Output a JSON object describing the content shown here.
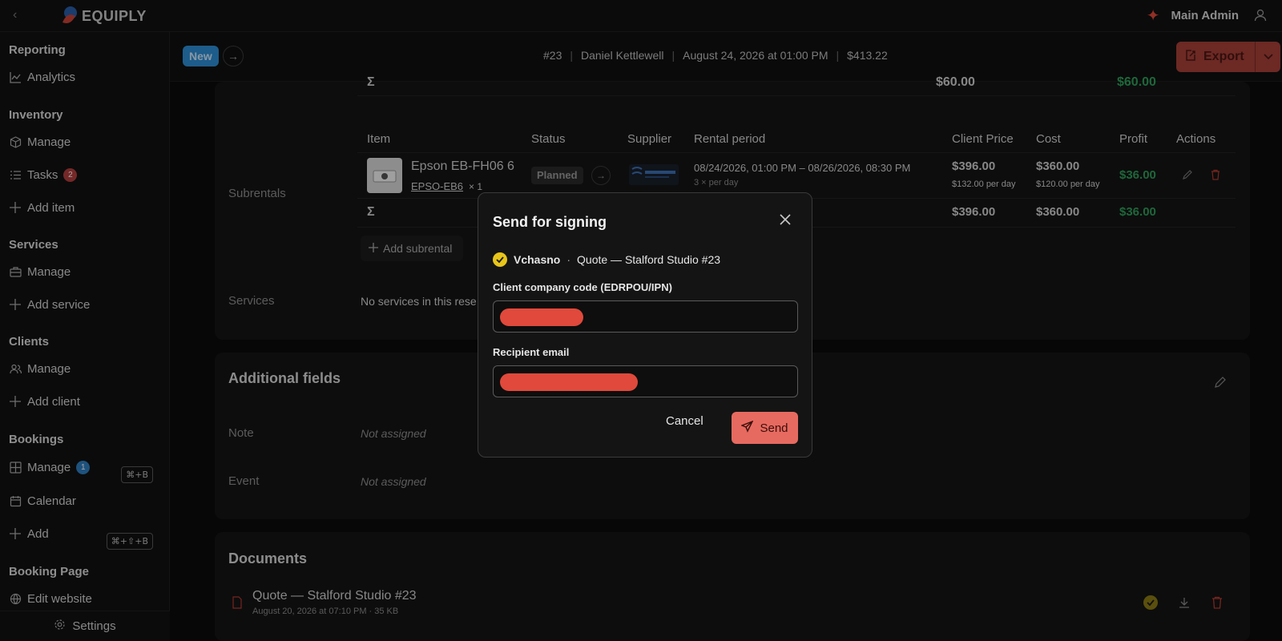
{
  "app": {
    "name": "EQUIPLY",
    "user": "Main Admin"
  },
  "sidebar": {
    "sections": [
      {
        "title": "Reporting",
        "items": [
          {
            "label": "Analytics",
            "icon": "chart-icon"
          }
        ]
      },
      {
        "title": "Inventory",
        "items": [
          {
            "label": "Manage",
            "icon": "box-icon"
          },
          {
            "label": "Tasks",
            "icon": "list-icon",
            "badge": "2"
          },
          {
            "label": "Add item",
            "icon": "plus-icon"
          }
        ]
      },
      {
        "title": "Services",
        "items": [
          {
            "label": "Manage",
            "icon": "toolbox-icon"
          },
          {
            "label": "Add service",
            "icon": "plus-icon"
          }
        ]
      },
      {
        "title": "Clients",
        "items": [
          {
            "label": "Manage",
            "icon": "users-icon"
          },
          {
            "label": "Add client",
            "icon": "plus-icon"
          }
        ]
      },
      {
        "title": "Bookings",
        "items": [
          {
            "label": "Manage",
            "icon": "grid-icon",
            "badge": "1",
            "shortcut": "⌘+B"
          },
          {
            "label": "Calendar",
            "icon": "calendar-icon"
          },
          {
            "label": "Add",
            "icon": "plus-icon",
            "shortcut": "⌘+⇧+B"
          }
        ]
      },
      {
        "title": "Booking Page",
        "items": [
          {
            "label": "Edit website",
            "icon": "globe-icon"
          }
        ]
      }
    ],
    "settings": "Settings"
  },
  "header": {
    "status": "New",
    "number": "#23",
    "client": "Daniel Kettlewell",
    "date": "August 24, 2026 at 01:00 PM",
    "total": "$413.22",
    "export": "Export"
  },
  "subrentals": {
    "section_label": "Subrentals",
    "columns": [
      "Item",
      "Status",
      "Supplier",
      "Rental period",
      "Client Price",
      "Cost",
      "Profit",
      "Actions"
    ],
    "row": {
      "name": "Epson EB-FH06 6",
      "sku": "EPSO-EB6",
      "qty": "× 1",
      "status": "Planned",
      "period": "08/24/2026, 01:00 PM – 08/26/2026, 08:30 PM",
      "period_note": "3 × per day",
      "client_price": "$396.00",
      "client_price_note": "$132.00 per day",
      "cost": "$360.00",
      "cost_note": "$120.00 per day",
      "profit": "$36.00"
    },
    "sum": {
      "symbol": "Σ",
      "client_price": "$396.00",
      "cost": "$360.00",
      "profit": "$36.00"
    },
    "top_sum": {
      "symbol": "Σ",
      "client_price": "$60.00",
      "profit": "$60.00"
    },
    "add": "Add subrental"
  },
  "services": {
    "label": "Services",
    "empty": "No services in this rese"
  },
  "additional": {
    "title": "Additional fields",
    "fields": [
      {
        "label": "Note",
        "value": "Not assigned"
      },
      {
        "label": "Event",
        "value": "Not assigned"
      }
    ]
  },
  "documents": {
    "title": "Documents",
    "item": {
      "name": "Quote — Stalford Studio #23",
      "meta": "August 20, 2026 at 07:10 PM · 35 KB"
    }
  },
  "modal": {
    "title": "Send for signing",
    "provider": "Vchasno",
    "dot": "·",
    "document": "Quote — Stalford Studio #23",
    "company_label": "Client company code (EDRPOU/IPN)",
    "email_label": "Recipient email",
    "cancel": "Cancel",
    "send": "Send"
  },
  "colors": {
    "accent": "#e0493b",
    "new_badge": "#2d8ed6",
    "profit": "#2f9e5a",
    "vchasno": "#e8c51a"
  }
}
